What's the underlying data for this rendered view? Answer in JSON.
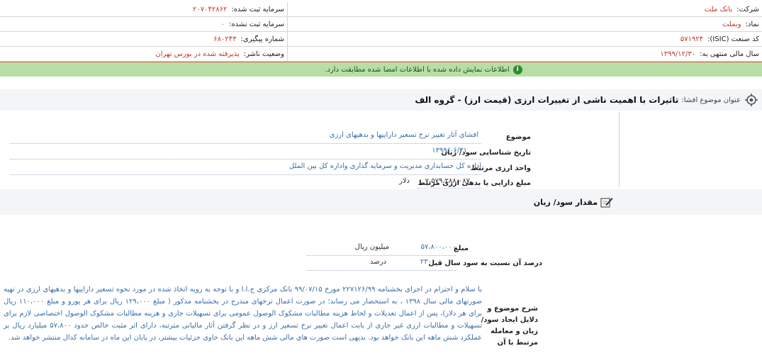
{
  "header": {
    "rows": [
      {
        "right_label": "شرکت:",
        "right_value": "بانک ملت",
        "left_label": "سرمایه ثبت شده:",
        "left_value": "۲۰۷۰۴۲۸۶۲"
      },
      {
        "right_label": "نماد:",
        "right_value": "وبملت",
        "left_label": "سرمایه ثبت نشده:",
        "left_value": "۰"
      },
      {
        "right_label": "کد صنعت (ISIC):",
        "right_value": "۵۷۱۹۲۴",
        "left_label": "شماره پیگیری:",
        "left_value": "۶۸۰۲۴۳"
      },
      {
        "right_label": "سال مالی منتهی به:",
        "right_value": "۱۳۹۹/۱۲/۳۰",
        "left_label": "وضعیت ناشر:",
        "left_value": "پذیرفته شده در بورس تهران"
      }
    ]
  },
  "notice": {
    "icon": "info-icon",
    "text": "اطلاعات نمایش داده شده با اطلاعات امضا شده مطابقت دارد."
  },
  "title": {
    "icon": "target-icon",
    "label": "عنوان موضوع افشا:",
    "text": "تاثیرات با اهمیت ناشی از تغییرات ارزی (قیمت ارز) - گروه الف"
  },
  "fields": {
    "subject_label": "موضوع",
    "subject_value": "افشای آثار تغییر نرخ تسعیر داراییها و بدهیهای ارزی",
    "date_label": "تاریخ شناسایی سود/ زیان",
    "date_value": "۱۳۹۹/۰۶/۳۱",
    "unit_label": "واحد ارزی مرتبط",
    "unit_value": "اداره کل حسابداری مدیریت و سرمایه گذاری واداره کل بین الملل",
    "amount_label": "مبلغ دارایی یا بدهی ارزی مرتبط",
    "amount_value": "۷،۵۷۹،۲۸۸،۰۸۷",
    "amount_unit": "دلار"
  },
  "section": {
    "icon": "edit-icon",
    "title": "مقدار سود/ زیان"
  },
  "profit": {
    "amount_label": "مبلغ",
    "amount_value": "۵۷،۸۰۰،۰۰۰",
    "amount_unit": "میلیون ریال",
    "percent_label": "درصد آن نسبت به سود سال قبل",
    "percent_value": "۲۳۰",
    "percent_unit": "درصد"
  },
  "description": {
    "label": "شرح موضوع و دلایل ایجاد سود/ زیان و معامله مرتبط با آن",
    "text": "با سلام و احترام در اجرای بخشنامه ۲۲۷۱۲۶/۹۹ مورخ ۹۹/۰۷/۱۵ بانک مرکزی ج.ا.ا و با توجه به رویه اتخاذ شده در مورد نحوه تسعیر داراییها و بدهیهای ارزی در تهیه صورتهای مالی سال ۱۳۹۸ ، به استحضار می رساند؛ در صورت اعمال نرخهای مندرج در بخشنامه مذکور ( مبلغ ۱۲۹،۰۰۰ ریال برای هر یورو و مبلغ ۱۱۰،۰۰۰ ریال برای هر دلار)، پس از اعمال تعدیلات و لحاظ هزینه مطالبات مشکوک الوصول عمومی برای تسهیلات جاری و هزینه مطالبات مشکوک الوصول اختصاصی لازم برای تسهیلات و مطالبات ارزی غیر جاری از بابت اعمال تغییر نرخ تسعیر ارز و در نظر گرفتن آثار مالیاتی مترتبه، دارای اثر مثبت خالص حدود ۵۷،۸۰۰ میلیارد ریال بر عملکرد شش ماهه این بانک خواهد بود. بدیهی است صورت های مالی شش ماهه این بانک حاوی جزئیات بیشتر، در پایان این ماه در سامانه کدال منتشر خواهد شد."
  }
}
